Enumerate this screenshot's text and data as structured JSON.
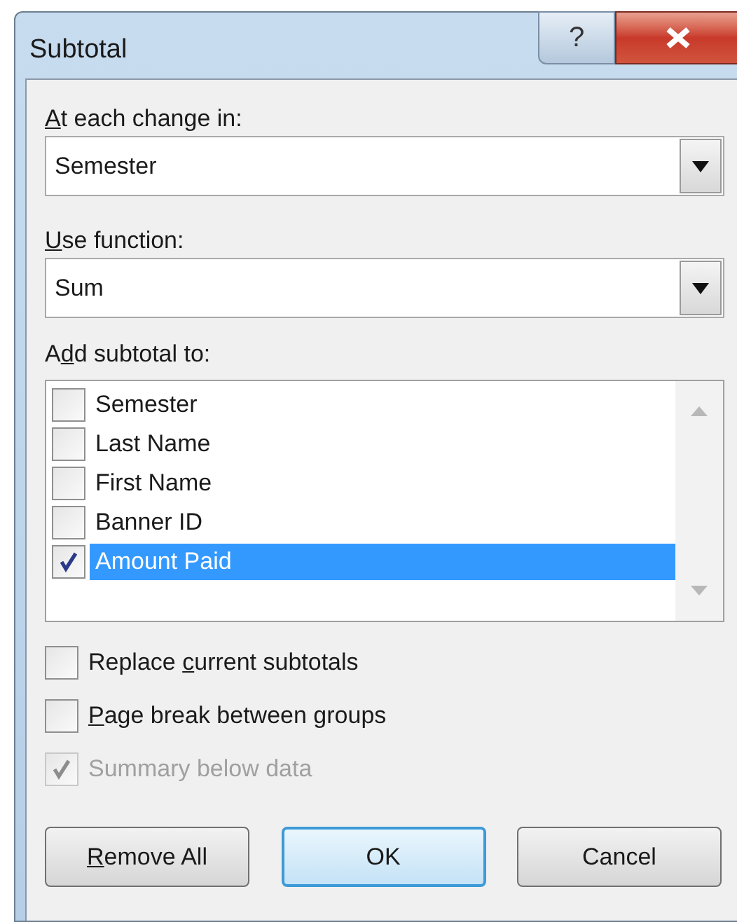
{
  "window": {
    "title": "Subtotal",
    "help_button": "?"
  },
  "change_field": {
    "label": {
      "key": "A",
      "after": "t each change in:"
    },
    "value": "Semester"
  },
  "function_field": {
    "label": {
      "key": "U",
      "after": "se function:"
    },
    "value": "Sum"
  },
  "subtotal_list": {
    "label": {
      "before": "A",
      "key": "d",
      "after": "d subtotal to:"
    },
    "items": [
      {
        "label": "Semester",
        "checked": false,
        "selected": false
      },
      {
        "label": "Last Name",
        "checked": false,
        "selected": false
      },
      {
        "label": "First Name",
        "checked": false,
        "selected": false
      },
      {
        "label": "Banner ID",
        "checked": false,
        "selected": false
      },
      {
        "label": "Amount Paid",
        "checked": true,
        "selected": true
      }
    ]
  },
  "options": [
    {
      "label": {
        "before": "Replace ",
        "key": "c",
        "after": "urrent subtotals"
      },
      "checked": false,
      "disabled": false
    },
    {
      "label": {
        "key": "P",
        "after": "age break between groups"
      },
      "checked": false,
      "disabled": false
    },
    {
      "label": {
        "before": "Summary below data"
      },
      "checked": true,
      "disabled": true
    }
  ],
  "buttons": [
    {
      "label": {
        "key": "R",
        "after": "emove All"
      },
      "default": false
    },
    {
      "label": {
        "before": "OK"
      },
      "default": true
    },
    {
      "label": {
        "before": "Cancel"
      },
      "default": false
    }
  ]
}
